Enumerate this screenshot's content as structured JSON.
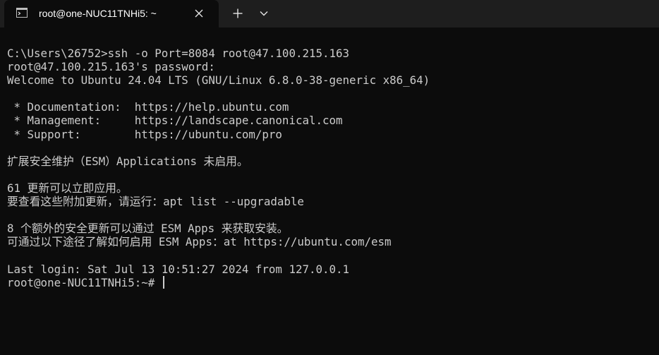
{
  "tab": {
    "title": "root@one-NUC11TNHi5: ~",
    "icon": "terminal-icon"
  },
  "titlebar": {
    "close_icon": "close-icon",
    "new_tab_icon": "plus-icon",
    "dropdown_icon": "chevron-down-icon"
  },
  "terminal": {
    "lines": [
      "",
      "C:\\Users\\26752>ssh -o Port=8084 root@47.100.215.163",
      "root@47.100.215.163's password:",
      "Welcome to Ubuntu 24.04 LTS (GNU/Linux 6.8.0-38-generic x86_64)",
      "",
      " * Documentation:  https://help.ubuntu.com",
      " * Management:     https://landscape.canonical.com",
      " * Support:        https://ubuntu.com/pro",
      "",
      "扩展安全维护（ESM）Applications 未启用。",
      "",
      "61 更新可以立即应用。",
      "要查看这些附加更新，请运行：apt list --upgradable",
      "",
      "8 个额外的安全更新可以通过 ESM Apps 来获取安装。",
      "可通过以下途径了解如何启用 ESM Apps：at https://ubuntu.com/esm",
      "",
      "Last login: Sat Jul 13 10:51:27 2024 from 127.0.0.1"
    ],
    "prompt": "root@one-NUC11TNHi5:~# "
  }
}
